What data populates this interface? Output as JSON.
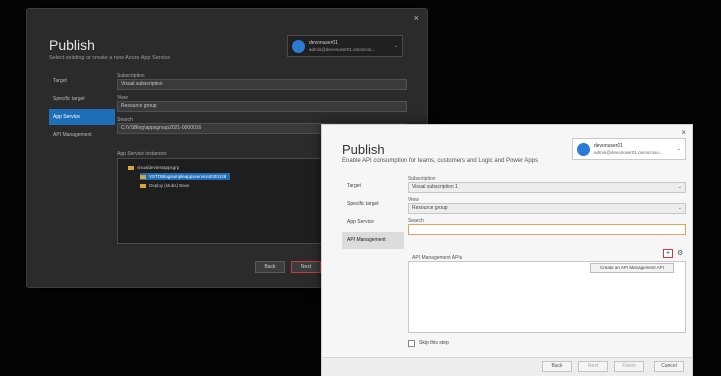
{
  "dark_dialog": {
    "title": "Publish",
    "subtitle": "Select existing or create a new Azure App Service",
    "close_glyph": "×",
    "account": {
      "name": "devonuser01",
      "email": "admin@devonuser01.onmicros..."
    },
    "nav_items": [
      "Target",
      "Specific target",
      "App Service",
      "API Management"
    ],
    "active_nav": 2,
    "fields": [
      {
        "label": "Subscription",
        "value": "Visual subscription"
      },
      {
        "label": "View",
        "value": "Resource group"
      },
      {
        "label": "Search",
        "value": "C:\\VSBlog\\appsgroup2021-0000016"
      }
    ],
    "tree_label": "App Service instances",
    "tree": {
      "group": "visualdevtestappsgrp",
      "selected": "VSTOBlogsampleappsservice2020128",
      "item": "Deploy (stubs) Base"
    },
    "buttons": {
      "back": "Back",
      "next": "Next"
    }
  },
  "light_dialog": {
    "title": "Publish",
    "subtitle": "Enable API consumption for teams, customers and Logic and Power Apps",
    "close_glyph": "×",
    "account": {
      "name": "devonuser01",
      "email": "admin@devonuser01.onmicroso..."
    },
    "nav_items": [
      "Target",
      "Specific target",
      "App Service",
      "API Management"
    ],
    "active_nav": 3,
    "fields": {
      "subscription_label": "Subscription",
      "subscription_value": "Visual subscription 1",
      "view_label": "View",
      "view_value": "Resource group",
      "search_label": "Search"
    },
    "apim_label": "API Management APIs",
    "tooltip": "Create an API Management API",
    "checkbox_label": "Skip this step",
    "buttons": {
      "back": "Back",
      "next": "Next",
      "finish": "Finish",
      "cancel": "Cancel"
    }
  },
  "icons": {
    "chevron": "⌄",
    "plus": "+",
    "gear": "⚙"
  },
  "colors": {
    "accent_blue": "#1f6fb8",
    "focus_red": "#d03a3a",
    "input_focus": "#e3a25e"
  }
}
